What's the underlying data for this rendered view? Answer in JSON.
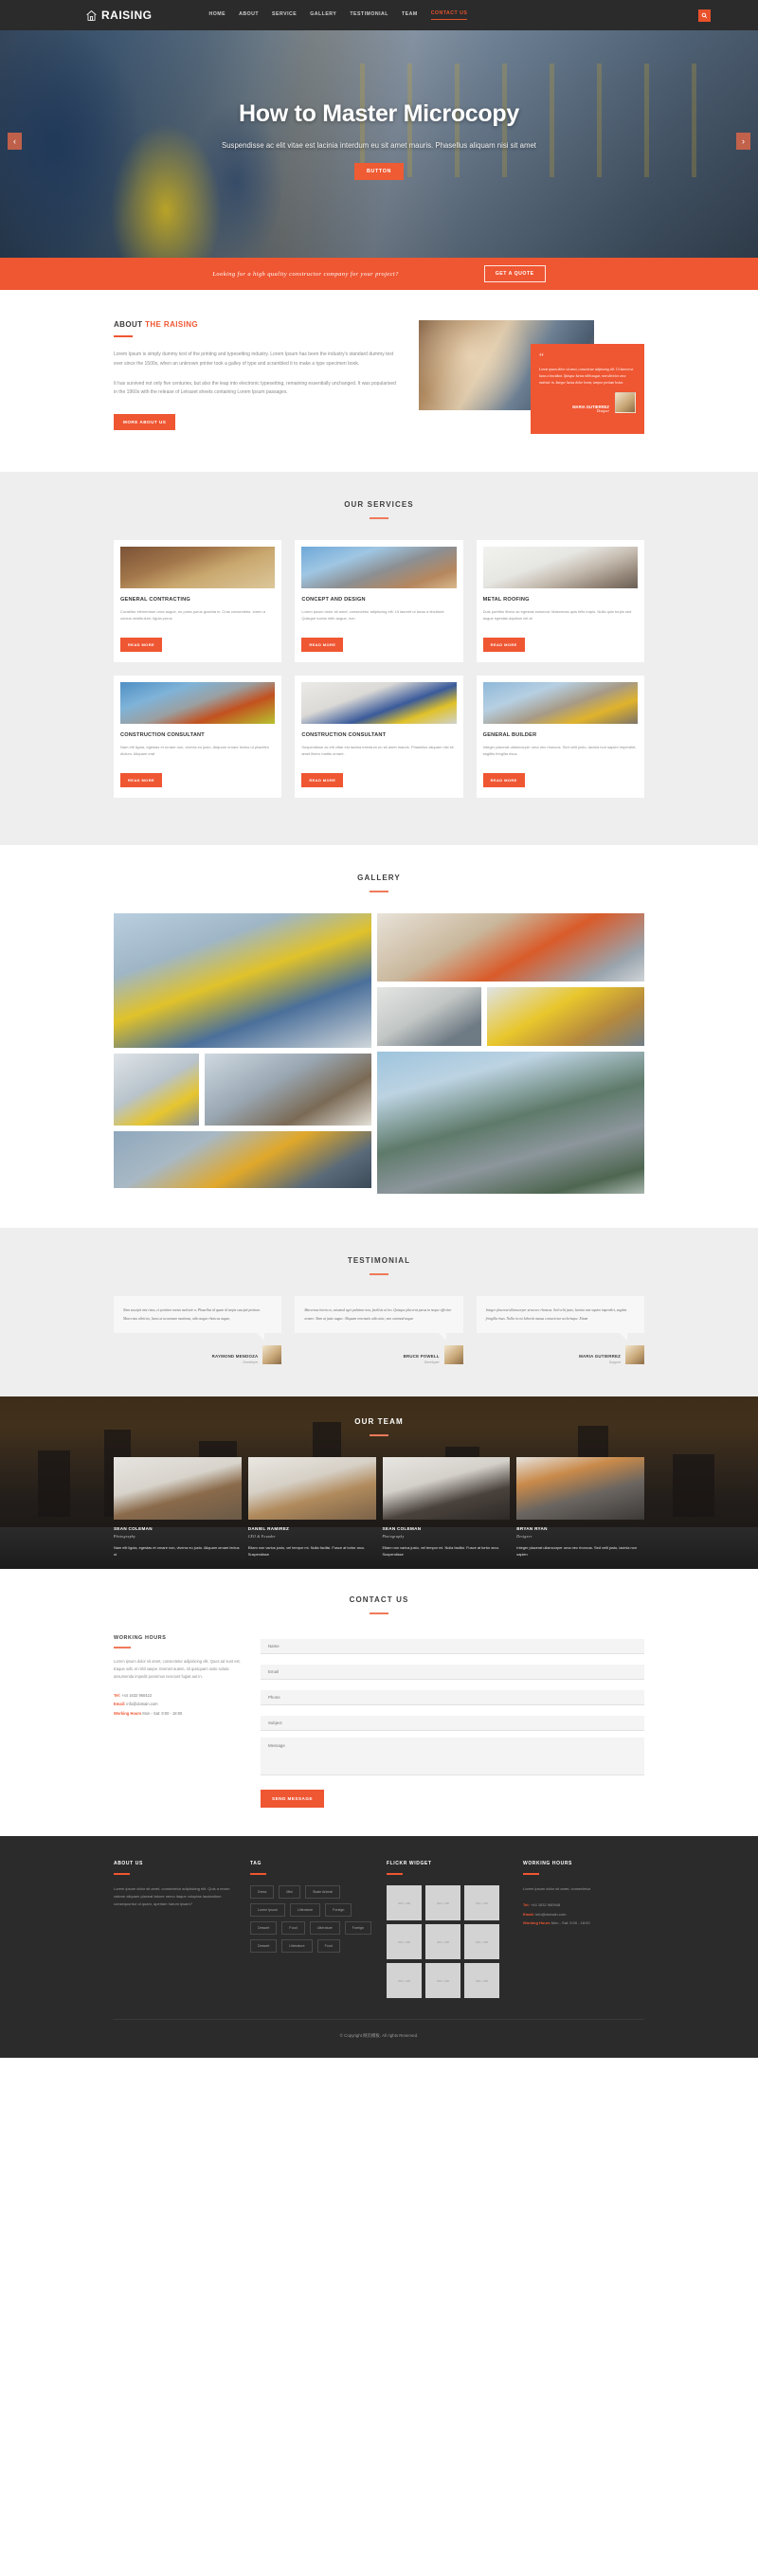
{
  "header": {
    "logo_text": "RAISING",
    "logo_icon": "home-icon",
    "search_icon": "search-icon",
    "nav": [
      {
        "label": "HOME",
        "active": false
      },
      {
        "label": "ABOUT",
        "active": false
      },
      {
        "label": "SERVICE",
        "active": false
      },
      {
        "label": "GALLERY",
        "active": false
      },
      {
        "label": "TESTIMONIAL",
        "active": false
      },
      {
        "label": "TEAM",
        "active": false
      },
      {
        "label": "CONTACT US",
        "active": true
      }
    ]
  },
  "hero": {
    "title": "How to Master Microcopy",
    "subtitle": "Suspendisse ac elit vitae est lacinia interdum eu sit amet mauris. Phasellus aliquam nisi sit amet",
    "button": "BUTTON",
    "prev_icon": "chevron-left-icon",
    "next_icon": "chevron-right-icon"
  },
  "cta": {
    "text": "Looking for a high quality constructor company for your project?",
    "button": "GET A QUOTE"
  },
  "about": {
    "kicker_plain": "ABOUT ",
    "kicker_accent": "THE RAISING",
    "p1": "Lorem Ipsum is simply dummy text of the printing and typesetting industry. Lorem Ipsum has been the industry's standard dummy text ever since the 1500s, when an unknown printer took a galley of type and scrambled it to make a type specimen book.",
    "p2": "It has survived not only five centuries, but also the leap into electronic typesetting, remaining essentially unchanged. It was popularised in the 1960s with the release of Letraset sheets containing Lorem Ipsum passages.",
    "button": "MORE ABOUT US",
    "quote": {
      "mark": "“",
      "text": "Lorem ipsum dolor sit amet, consectetur adipiscing elit. Ut laoreet ut lacus a tincidunt. Quisque luctus nibh augue, non ultricies arcu molestie in. Integer luctus dolor lorem, tempor pretium lectus",
      "name": "MARIA GUTIERREZ",
      "role": "Designer"
    }
  },
  "services": {
    "title": "OUR SERVICES",
    "read_more": "READ MORE",
    "cards": [
      {
        "title": "GENERAL CONTRACTING",
        "desc": "Curabitur elementum urna augue, eu porta purus gravida in. Cras consectetur, lorem a cursus vestibulum, ligula purus"
      },
      {
        "title": "CONCEPT AND DESIGN",
        "desc": "Lorem ipsum dolor sit amet, consectetur adipiscing elit. Ut laoreet ut lacus a tincidunt. Quisque luctus nibh augue, non"
      },
      {
        "title": "METAL ROOFING",
        "desc": "Duis porttitor libero ac egestas euismod. Maecenas quis felis turpis. Nulla quis turpis sed augue egestas dapibus vel at"
      },
      {
        "title": "CONSTRUCTION CONSULTANT",
        "desc": "Nam elit ligula, egestas et ornare non, viverra eu justo. Aliquam ornare lectus ut pharetra dictum. Aliquam erat"
      },
      {
        "title": "CONSTRUCTION CONSULTANT",
        "desc": "Suspendisse ac elit vitae est lacinia interdum eu sit amet mauris. Phasellus aliquam nisi sit amet libero mattis ornare."
      },
      {
        "title": "GENERAL BUILDER",
        "desc": "Integer placerat ullamcorper urna nec rhoncus. Sed velit justo, lacinia non sapien imperdiet, sagittis fringilla risus."
      }
    ]
  },
  "gallery": {
    "title": "GALLERY"
  },
  "testimonial": {
    "title": "TESTIMONIAL",
    "items": [
      {
        "text": "Nam suscipit nisi risus, et porttitor metus molestie a. Phasellus id quam id turpis suscipit pretium. Maecenas ultricies, lacus ut accumsan maximus, odio augue rhoncus augue,",
        "name": "RAYMOND MENDOZA",
        "role": "Developer"
      },
      {
        "text": "Maecenas lorem ex, euismod eget pulvinar non, facilisis ut leo. Quisque placerat purus in neque efficitur ornare. Nam at justo augue. Aliquam venenatis odio ante, non euismod augue",
        "name": "BRUCE POWELL",
        "role": "Developer"
      },
      {
        "text": "Integer placerat ullamcorper urna nec rhoncus. Sed velit justo, lacinia non sapien imperdiet, sagittis fringilla risus. Nulla in est lobortis massa consectetur scelerisque. Etiam",
        "name": "MARIA GUTIERREZ",
        "role": "Support"
      }
    ]
  },
  "team": {
    "title": "OUR TEAM",
    "members": [
      {
        "name": "SEAN COLEMAN",
        "role": "Photography",
        "desc": "Nam elit ligula, egestas et ornare non, viverra eu justo. Aliquam ornare lectus ut"
      },
      {
        "name": "DANIEL RAMIREZ",
        "role": "CEO & Founder",
        "desc": "Etiam non varius justo, vel tempor mi. Nulla facilisi. Fusce at tortor arcu. Suspendisse"
      },
      {
        "name": "SEAN COLEMAN",
        "role": "Photography",
        "desc": "Etiam non varius justo, vel tempor mi. Nulla facilisi. Fusce at tortor arcu. Suspendisse"
      },
      {
        "name": "BRYAN RYAN",
        "role": "Designer",
        "desc": "Integer placerat ullamcorper urna nec rhoncus. Sed velit justo, lacinia non sapien"
      }
    ]
  },
  "contact": {
    "title": "CONTACT US",
    "hours_title": "WORKING HOURS",
    "hours_p": "Lorem ipsum dolor sit amet, consectetur adipisicing elit. Quos ad sunt est. Eaque odit, et nihil saepe. Eveniet autem, sit quisquam iusto soluta assumenda impedit possimus nesciunt fugiat aut in.",
    "tel_label": "Tel:",
    "tel_value": " +44 1632 960422",
    "email_label": "Email:",
    "email_value": " info@domain.com",
    "hours_label": "Working Hours",
    "hours_value": " Mon - Sat: 9:00 - 18:00",
    "fields": {
      "name": "Name",
      "email": "Email",
      "phone": "Phone",
      "subject": "Subject",
      "message": "Message"
    },
    "send_button": "SEND MESSAGE"
  },
  "footer": {
    "about_title": "ABOUT US",
    "about_p": "Lorem ipsum dolor sit amet, consectetur adipisicing elit. Quis a rerum ratione aliquam placeat labore nemo itaque voluptas laudantium consequuntur ut quam, aperiam harum ipsam?",
    "tag_title": "TAG",
    "tags": [
      "Dress",
      "Mini",
      "Skate Animal",
      "Lorem Ipsum",
      "Litterature",
      "Foreign",
      "Dessert",
      "Food",
      "Litterature",
      "Foreign",
      "Dessert",
      "Litterature",
      "Food"
    ],
    "flickr_title": "FLICKR WIDGET",
    "flickr_label": "400 x 400",
    "flickr_count": 9,
    "hours_title": "WORKING HOURS",
    "hours_p": "Lorem ipsum dolor sit amet, consectetur",
    "tel_label": "Tel:",
    "tel_value": " +44 1632 960948",
    "email_label": "Email:",
    "email_value": " info@domain.com",
    "wh_label": "Working Hours",
    "wh_value": " Mon - Sat: 9:00 - 18:00",
    "copyright": "© Copyright 网页模板. All rights Reserved."
  },
  "colors": {
    "accent": "#ef5632",
    "dark": "#2b2b2b",
    "light_grey": "#eeeeee"
  }
}
